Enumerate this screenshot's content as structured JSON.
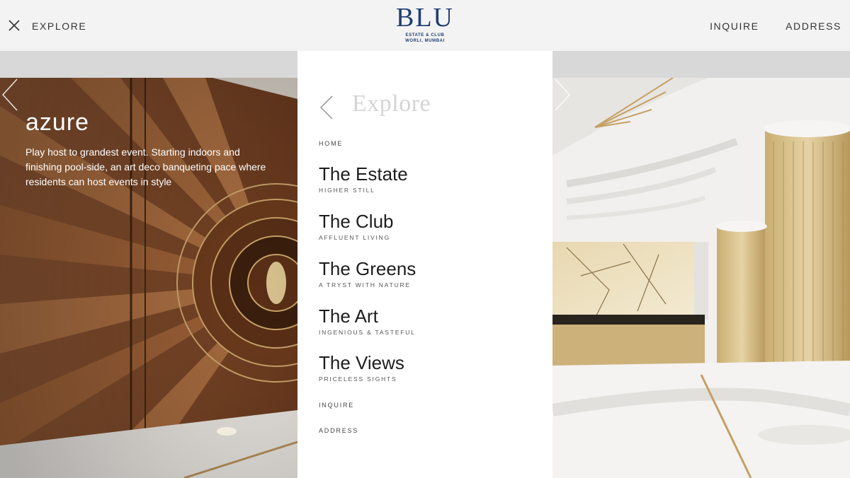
{
  "header": {
    "explore_label": "EXPLORE",
    "logo": {
      "mark": "BLU",
      "line1": "ESTATE & CLUB",
      "line2": "WORLI, MUMBAI"
    },
    "nav": [
      "INQUIRE",
      "ADDRESS"
    ]
  },
  "hero": {
    "title": "azure",
    "description": "Play host to grandest event. Starting indoors and finishing pool-side, an art deco banqueting pace where residents can host events in style"
  },
  "menu": {
    "heading": "Explore",
    "home_label": "HOME",
    "items": [
      {
        "title": "The Estate",
        "subtitle": "HIGHER STILL"
      },
      {
        "title": "The Club",
        "subtitle": "AFFLUENT LIVING"
      },
      {
        "title": "The Greens",
        "subtitle": "A TRYST WITH NATURE"
      },
      {
        "title": "The Art",
        "subtitle": "INGENIOUS & TASTEFUL"
      },
      {
        "title": "The Views",
        "subtitle": "PRICELESS SIGHTS"
      }
    ],
    "inquire_label": "INQUIRE",
    "address_label": "ADDRESS"
  },
  "colors": {
    "brand_navy": "#1f3d73",
    "header_bg": "#f3f3f3",
    "panel_bg": "#ffffff",
    "heading_grey": "#d4d4d4"
  },
  "icons": [
    "close-icon",
    "chevron-left-icon",
    "chevron-right-icon"
  ]
}
